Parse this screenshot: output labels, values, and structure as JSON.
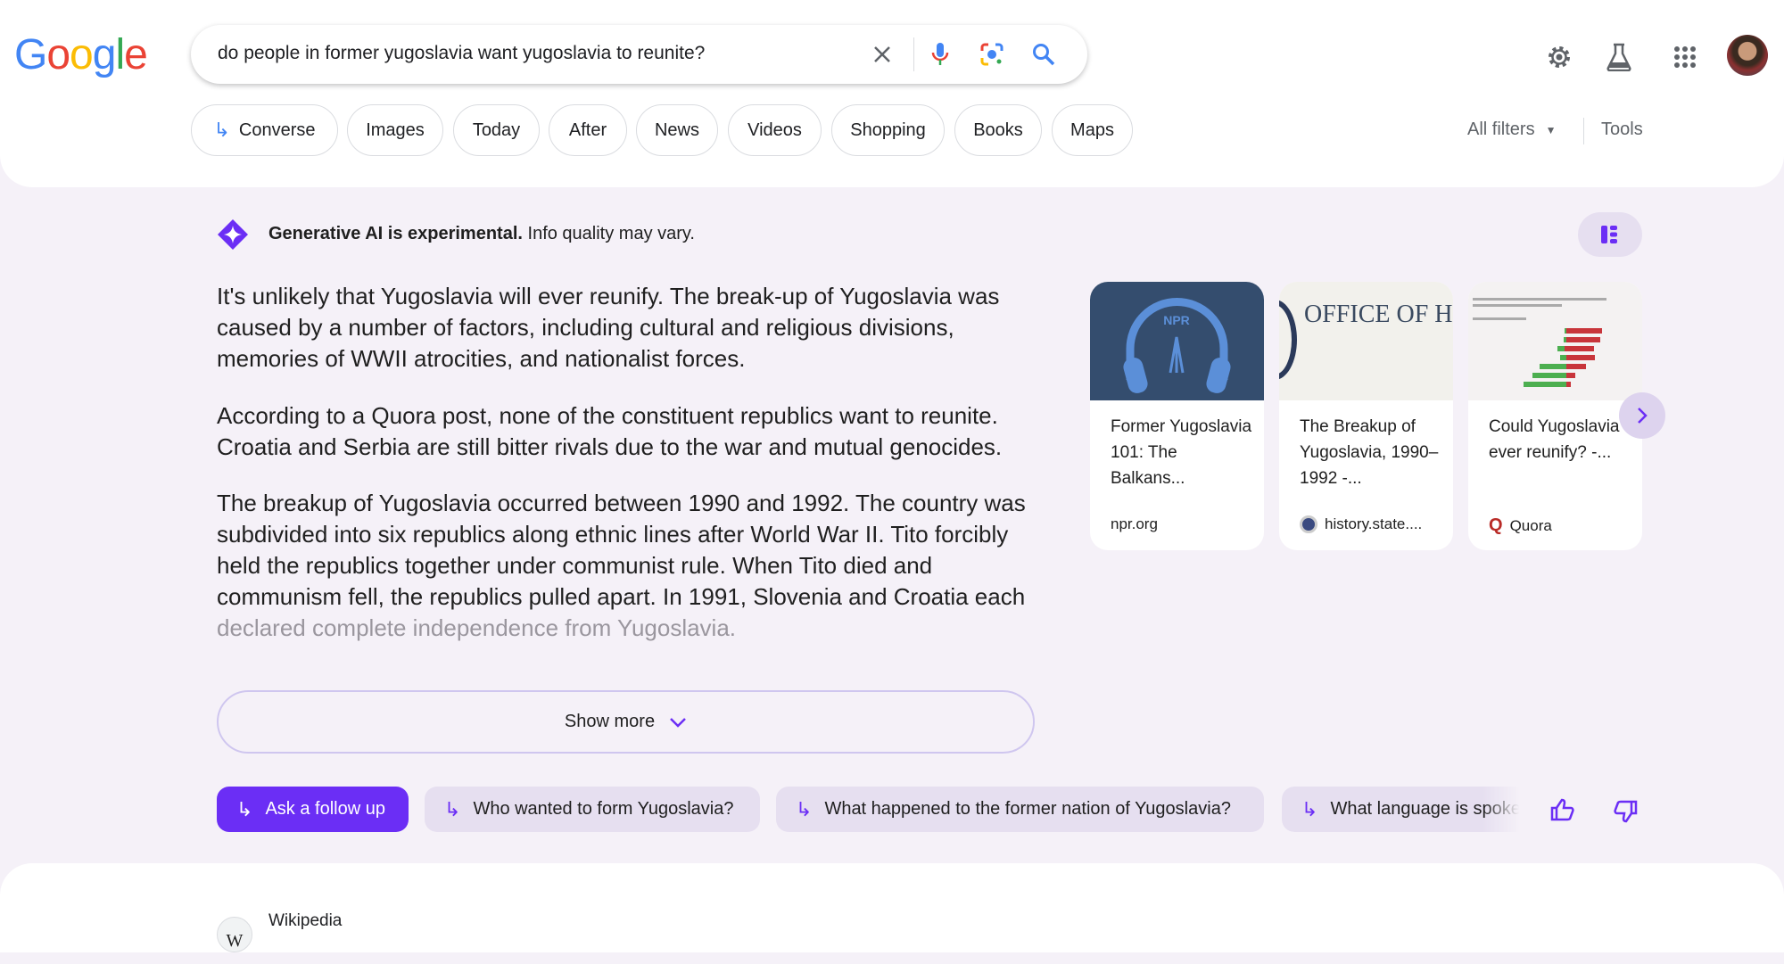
{
  "header": {
    "logo": "Google",
    "query": "do people in former yugoslavia want yugoslavia to reunite?",
    "icons": [
      "close-icon",
      "microphone-icon",
      "lens-icon",
      "search-icon",
      "settings-icon",
      "labs-flask-icon",
      "apps-grid-icon",
      "avatar"
    ]
  },
  "chips": [
    {
      "label": "Converse",
      "icon": "follow-up-arrow-icon"
    },
    {
      "label": "Images"
    },
    {
      "label": "Today"
    },
    {
      "label": "After"
    },
    {
      "label": "News"
    },
    {
      "label": "Videos"
    },
    {
      "label": "Shopping"
    },
    {
      "label": "Books"
    },
    {
      "label": "Maps"
    }
  ],
  "filters": {
    "all_filters": "All filters",
    "tools": "Tools"
  },
  "ai": {
    "disclaimer_bold": "Generative AI is experimental.",
    "disclaimer_rest": " Info quality may vary.",
    "paragraphs": [
      "It's unlikely that Yugoslavia will ever reunify. The break-up of Yugoslavia was caused by a number of factors, including cultural and religious divisions, memories of WWII atrocities, and nationalist forces.",
      "According to a Quora post, none of the constituent republics want to reunite. Croatia and Serbia are still bitter rivals due to the war and mutual genocides.",
      "The breakup of Yugoslavia occurred between 1990 and 1992. The country was subdivided into six republics along ethnic lines after World War II. Tito forcibly held the republics together under communist rule. When Tito died and communism fell, the republics pulled apart. In 1991, Slovenia and Croatia each"
    ],
    "faded_line": "declared complete independence from Yugoslavia.",
    "show_more": "Show more",
    "cards": [
      {
        "title": "Former Yugoslavia 101: The Balkans...",
        "source": "npr.org",
        "image_text": "NPR"
      },
      {
        "title": "The Breakup of Yugoslavia, 1990–1992 -...",
        "source": "history.state....",
        "image_text": "OFFICE OF HISTORY"
      },
      {
        "title": "Could Yugoslavia ever reunify? -...",
        "source": "Quora"
      }
    ],
    "follow_ups": {
      "ask": "Ask a follow up",
      "suggestions": [
        "Who wanted to form Yugoslavia?",
        "What happened to the former nation of Yugoslavia?",
        "What language is spoke"
      ]
    },
    "accent": "#6b2ef5"
  },
  "result": {
    "site": "Wikipedia"
  }
}
